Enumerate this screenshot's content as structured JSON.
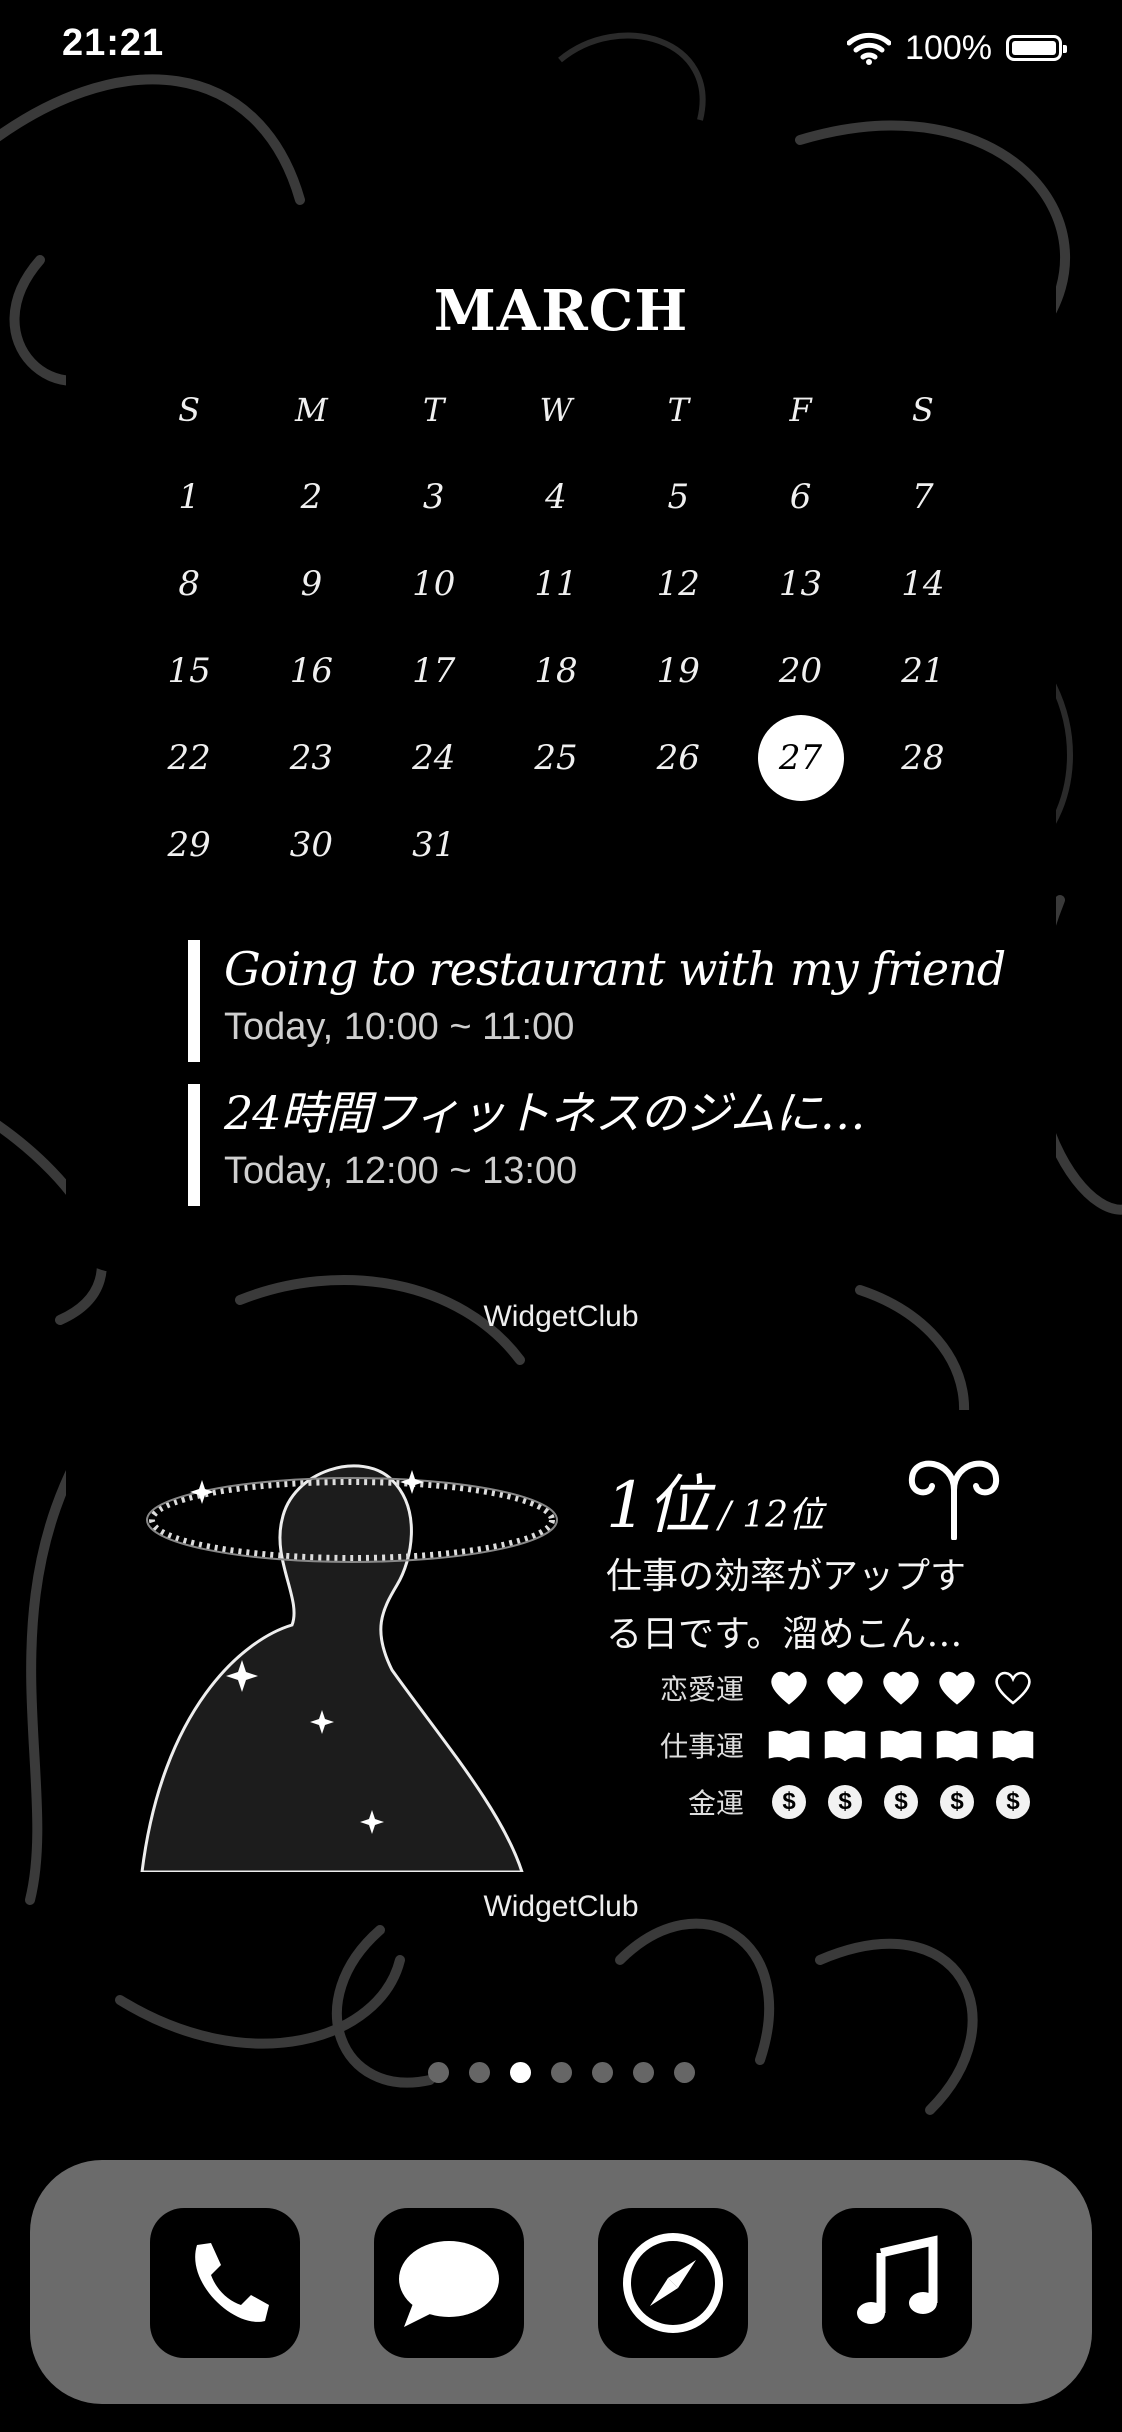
{
  "status": {
    "time": "21:21",
    "battery_percent": "100%",
    "battery_level": 1.0
  },
  "calendar": {
    "month": "MARCH",
    "weekdays": [
      "S",
      "M",
      "T",
      "W",
      "T",
      "F",
      "S"
    ],
    "weeks": [
      [
        "1",
        "2",
        "3",
        "4",
        "5",
        "6",
        "7"
      ],
      [
        "8",
        "9",
        "10",
        "11",
        "12",
        "13",
        "14"
      ],
      [
        "15",
        "16",
        "17",
        "18",
        "19",
        "20",
        "21"
      ],
      [
        "22",
        "23",
        "24",
        "25",
        "26",
        "27",
        "28"
      ],
      [
        "29",
        "30",
        "31",
        "",
        "",
        "",
        ""
      ]
    ],
    "today": "27",
    "events": [
      {
        "title": "Going to restaurant with my friend",
        "time": "Today, 10:00 ~ 11:00"
      },
      {
        "title": "24時間フィットネスのジムに…",
        "time": "Today, 12:00 ~ 13:00"
      }
    ]
  },
  "widget_labels": [
    "WidgetClub",
    "WidgetClub"
  ],
  "fortune": {
    "rank": "1位",
    "total": "/ 12位",
    "text_line1": "仕事の効率がアップす",
    "text_line2": "る日です。溜めこん…",
    "rows": [
      {
        "label": "恋愛運",
        "icon": "heart-icon",
        "rating": 4,
        "max": 5
      },
      {
        "label": "仕事運",
        "icon": "book-icon",
        "rating": 5,
        "max": 5
      },
      {
        "label": "金運",
        "icon": "coin-icon",
        "rating": 5,
        "max": 5,
        "glyph": "$"
      }
    ],
    "zodiac_icon": "aries-icon"
  },
  "page_dots": {
    "count": 7,
    "active_index": 2
  },
  "dock": {
    "apps": [
      "phone-icon",
      "messages-icon",
      "safari-icon",
      "music-icon"
    ]
  }
}
